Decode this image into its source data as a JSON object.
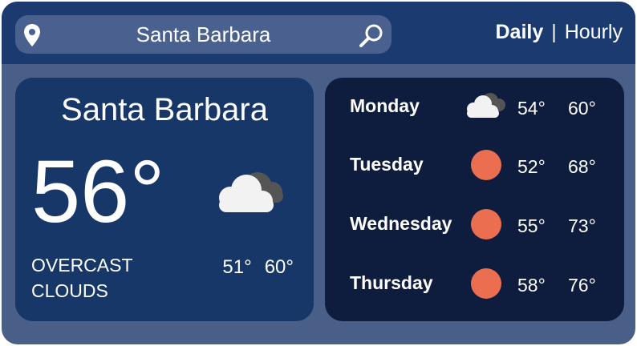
{
  "search": {
    "query": "Santa Barbara",
    "icon_left": "location-pin-icon",
    "icon_right": "search-icon"
  },
  "view_toggle": {
    "daily": "Daily",
    "separator": "|",
    "hourly": "Hourly",
    "selected": "Daily"
  },
  "current": {
    "city": "Santa Barbara",
    "temperature": "56°",
    "condition_line1": "OVERCAST",
    "condition_line2": "CLOUDS",
    "low": "51°",
    "high": "60°",
    "icon": "overcast-cloud-icon"
  },
  "forecast": [
    {
      "day": "Monday",
      "low": "54°",
      "high": "60°",
      "icon": "overcast-cloud-icon"
    },
    {
      "day": "Tuesday",
      "low": "52°",
      "high": "68°",
      "icon": "sun-icon"
    },
    {
      "day": "Wednesday",
      "low": "55°",
      "high": "73°",
      "icon": "sun-icon"
    },
    {
      "day": "Thursday",
      "low": "58°",
      "high": "76°",
      "icon": "sun-icon"
    }
  ],
  "colors": {
    "frame": "#4a5f87",
    "topbar": "#1b3a70",
    "search_bg": "#4a6190",
    "current_panel": "#173768",
    "forecast_panel": "#0e1d3d",
    "sun": "#ec6e50",
    "cloud_light": "#f2f2f2",
    "cloud_dark": "#555555"
  }
}
